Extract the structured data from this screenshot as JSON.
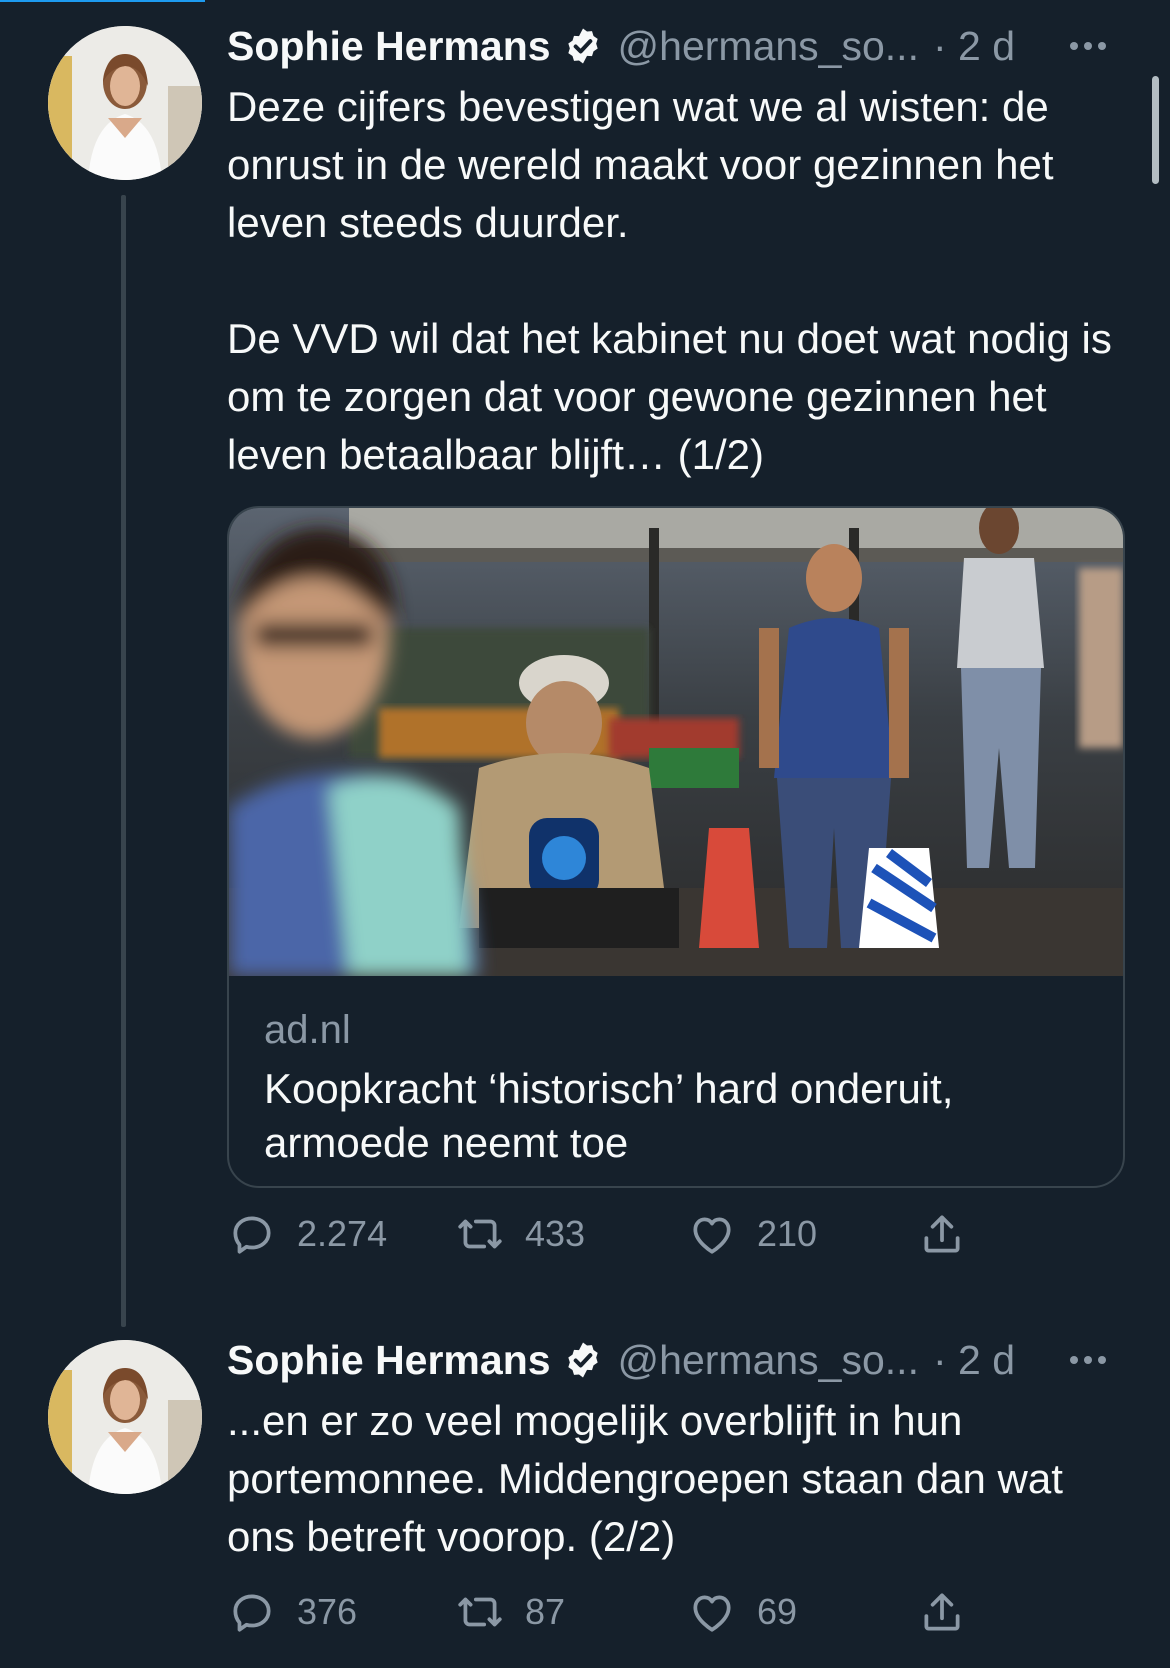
{
  "colors": {
    "background": "#15202b",
    "text_primary": "#f7f9f9",
    "text_secondary": "#8b98a5",
    "accent": "#1d9bf0",
    "border": "#38444d"
  },
  "tweets": [
    {
      "author": {
        "display_name": "Sophie Hermans",
        "handle": "@hermans_so...",
        "verified": true
      },
      "timestamp": "· 2 d",
      "text": "Deze cijfers bevestigen wat we al wisten: de onrust in de wereld maakt voor gezinnen het leven steeds duurder.\n\nDe VVD wil dat het kabinet nu doet wat nodig is om te zorgen dat voor gewone gezinnen het leven betaalbaar blijft… (1/2)",
      "link_card": {
        "domain": "ad.nl",
        "title": "Koopkracht ‘historisch’ hard onderuit, armoede neemt toe",
        "image": "street-market-photo"
      },
      "actions": {
        "replies": "2.274",
        "retweets": "433",
        "likes": "210"
      }
    },
    {
      "author": {
        "display_name": "Sophie Hermans",
        "handle": "@hermans_so...",
        "verified": true
      },
      "timestamp": "· 2 d",
      "text": "...en er zo veel mogelijk overblijft in hun portemonnee. Middengroepen staan dan wat ons betreft voorop. (2/2)",
      "actions": {
        "replies": "376",
        "retweets": "87",
        "likes": "69"
      }
    }
  ],
  "icons": {
    "reply": "reply-icon",
    "retweet": "retweet-icon",
    "like": "heart-icon",
    "share": "share-icon",
    "more": "more-options-icon",
    "verified": "verified-badge-icon"
  }
}
